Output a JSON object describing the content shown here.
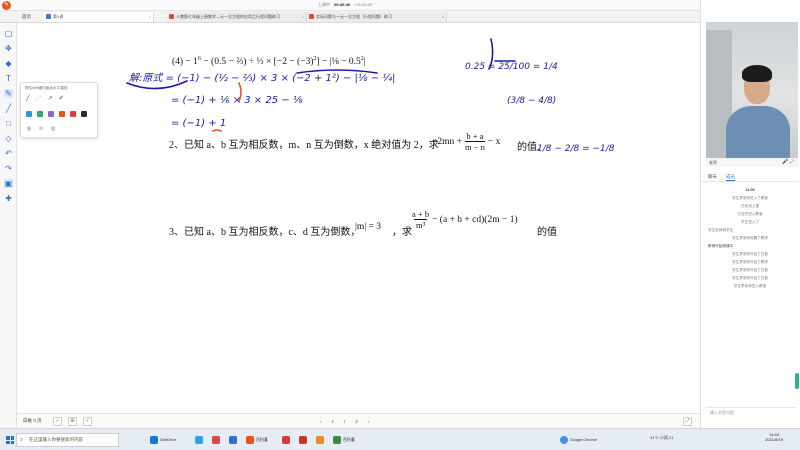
{
  "titlebar": {
    "time_prefix": "上课中",
    "elapsed": "00:46:40",
    "total": "/ 01:00:00",
    "leave_label": "退出"
  },
  "tabs": {
    "home": "首页",
    "items": [
      {
        "label": "第1讲"
      },
      {
        "label": "人教版七年级上册数学—元一次方程的应用之行程问题练习"
      },
      {
        "label": "实际问题与一元一次方程（行程问题）练习"
      }
    ]
  },
  "palette": {
    "title": "按住shift键可画出水平直线",
    "colors": [
      "#2b2b2b",
      "#2d9ad6",
      "#38a86a",
      "#8b6cc6",
      "#e8531f",
      "#e23b3b",
      "#2b2b2b"
    ],
    "sizes": [
      "细",
      "中",
      "粗"
    ]
  },
  "doc": {
    "expr4_lead": "(4)  − 1",
    "expr4_sup": "6",
    "expr4_rest": "− (0.5 − ⅔) ÷ ⅓ × [−2 − (−3)",
    "expr4_sup2": "2",
    "expr4_tail": "] − |⅛ − 0.5",
    "expr4_sup3": "2",
    "expr4_end": "|",
    "handwriting": [
      "解:原式 = (−1) − (½ − ⅔) × 3 × (−2 + 1²) − |⅛ − ¼|",
      "= (−1) + ⅙ × 3 × 25 − ⅛",
      "= (−1) + 1",
      "0.25 = 25/100 = 1/4",
      "(3/8 − 4/8)",
      "1/8 − 2/8 = −1/8"
    ],
    "q2": "2、已知 a、b 互为相反数，m、n 互为倒数，x 绝对值为 2，求",
    "q2_expr": "−2mn +",
    "q2_frac_num": "b + a",
    "q2_frac_den": "m − n",
    "q2_tail": "− x",
    "q2_end": "的值.",
    "q3": "3、已知 a、b 互为相反数，c、d 互为倒数，",
    "q3_abs": "|m| = 3",
    "q3_ask": "，求",
    "q3_frac_num": "a + b",
    "q3_frac_den": "m³",
    "q3_tail": "− (a + b + cd)(2m − 1)",
    "q3_end": "的值"
  },
  "boardbar": {
    "label": "白板 0 页",
    "page_current": "1",
    "page_sep": "/",
    "page_total": "2"
  },
  "video": {
    "name": "老师",
    "icons": "🎤 ⤢"
  },
  "right_tabs": [
    "聊天",
    "成员"
  ],
  "feed": {
    "time": "13:50",
    "lines": [
      "学生李老师进入了教室",
      "已在线上课",
      "已全员进入教室",
      "学生进入了",
      "学生老师到学生",
      "学生李老师设置了教学",
      "教师开始授课中",
      "学生李老师开启了白板",
      "学生李老师开启了教学",
      "学生李老师开启了白板",
      "学生李老师开启了白板",
      "学生李老师进入教室"
    ]
  },
  "chat_input": {
    "placeholder": "输入消息内容"
  },
  "taskbar": {
    "search_placeholder": "在这里输入你要搜索的内容",
    "apps": [
      {
        "label": "OneDrive",
        "color": "#1d74d8"
      },
      {
        "label": "",
        "color": "#2ea3e3"
      },
      {
        "label": "",
        "color": "#d94b3a"
      },
      {
        "label": "",
        "color": "#2f6fd3"
      },
      {
        "label": "百利通",
        "color": "#e8531f"
      },
      {
        "label": "",
        "color": "#d93a3a"
      },
      {
        "label": "",
        "color": "#c7332a"
      },
      {
        "label": "",
        "color": "#e88b1f"
      },
      {
        "label": "百利通",
        "color": "#3b8d3b"
      },
      {
        "label": "Google Chrome",
        "color": "#4a8fe7"
      }
    ],
    "weather": "31°C 小雨 21",
    "time": "14:43",
    "date": "2021/8/19"
  }
}
